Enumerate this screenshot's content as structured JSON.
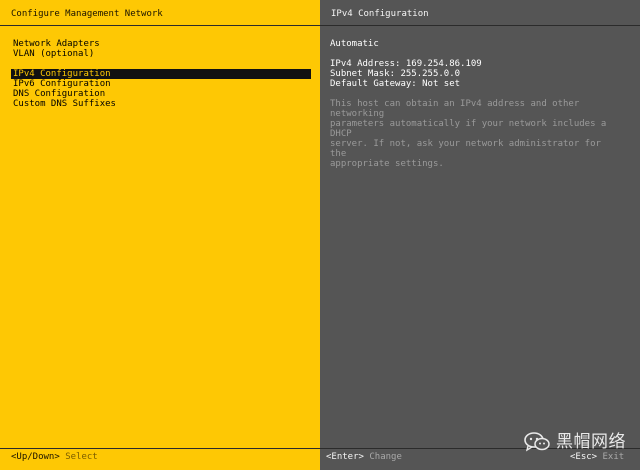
{
  "left": {
    "title": "Configure Management Network",
    "menu": [
      {
        "label": "Network Adapters"
      },
      {
        "label": "VLAN (optional)"
      },
      {
        "label": "IPv4 Configuration",
        "selected": true
      },
      {
        "label": "IPv6 Configuration"
      },
      {
        "label": "DNS Configuration"
      },
      {
        "label": "Custom DNS Suffixes"
      }
    ],
    "footer": {
      "key": "<Up/Down>",
      "action": "Select"
    }
  },
  "right": {
    "title": "IPv4 Configuration",
    "mode": "Automatic",
    "ipv4_address": "IPv4 Address: 169.254.86.109",
    "subnet_mask": "Subnet Mask: 255.255.0.0",
    "default_gateway": "Default Gateway: Not set",
    "description": "This host can obtain an IPv4 address and other networking\nparameters automatically if your network includes a DHCP\nserver. If not, ask your network administrator for the\nappropriate settings.",
    "footer": {
      "enter_key": "<Enter>",
      "enter_action": "Change",
      "esc_key": "<Esc>",
      "esc_action": "Exit"
    }
  },
  "watermark": {
    "text": "黑帽网络",
    "icon": "wechat-icon"
  },
  "colors": {
    "left_bg": "#fec804",
    "right_bg": "#555555",
    "selection_bg": "#111111",
    "selection_fg": "#fec804"
  }
}
